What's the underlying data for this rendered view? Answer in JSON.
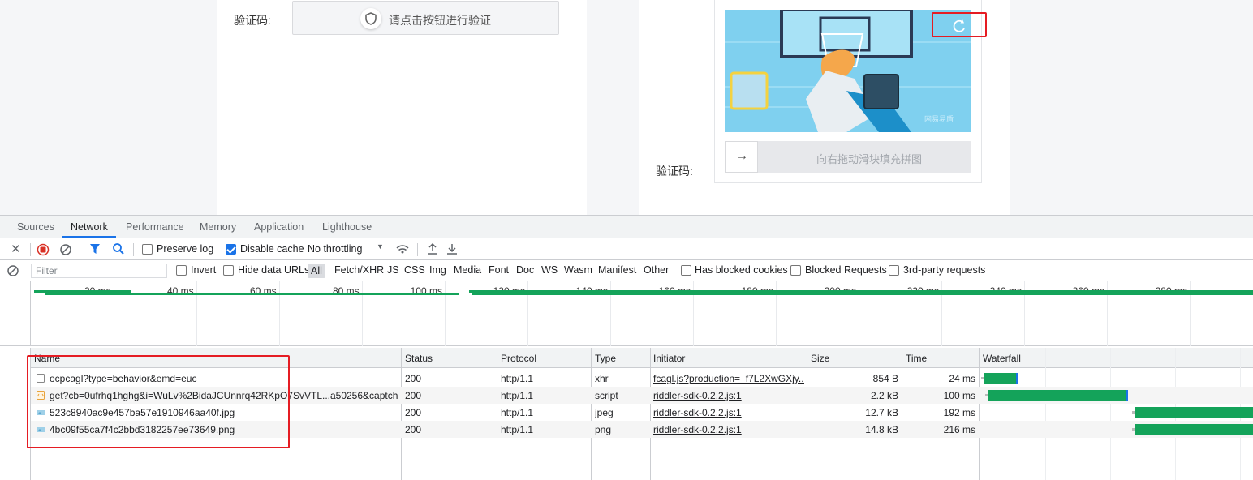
{
  "page": {
    "left_panel": {
      "label": "验证码:",
      "button_text": "请点击按钮进行验证"
    },
    "right_panel": {
      "label": "验证码:",
      "slider_text": "向右拖动滑块填充拼图",
      "handle_icon": "arrow-right-icon",
      "refresh_icon": "refresh-icon",
      "watermark": "网易易盾"
    }
  },
  "devtools": {
    "tabs": [
      "Sources",
      "Network",
      "Performance",
      "Memory",
      "Application",
      "Lighthouse"
    ],
    "active_tab": "Network",
    "toolbar": {
      "preserve_log": "Preserve log",
      "disable_cache": "Disable cache",
      "throttling": "No throttling"
    },
    "filter": {
      "placeholder": "Filter",
      "invert": "Invert",
      "hide_data_urls": "Hide data URLs",
      "all": "All",
      "types": [
        "Fetch/XHR",
        "JS",
        "CSS",
        "Img",
        "Media",
        "Font",
        "Doc",
        "WS",
        "Wasm",
        "Manifest",
        "Other"
      ],
      "has_blocked_cookies": "Has blocked cookies",
      "blocked_requests": "Blocked Requests",
      "third_party": "3rd-party requests"
    },
    "overview_ticks": [
      "20 ms",
      "40 ms",
      "60 ms",
      "80 ms",
      "100 ms",
      "120 ms",
      "140 ms",
      "160 ms",
      "180 ms",
      "200 ms",
      "220 ms",
      "240 ms",
      "260 ms",
      "280 ms",
      "300"
    ],
    "columns": [
      "Name",
      "Status",
      "Protocol",
      "Type",
      "Initiator",
      "Size",
      "Time",
      "Waterfall"
    ],
    "requests": [
      {
        "name": "ocpcagl?type=behavior&emd=euc",
        "status": "200",
        "protocol": "http/1.1",
        "type": "xhr",
        "initiator": "fcagl.js?production=_f7L2XwGXjy...",
        "size": "854 B",
        "time": "24 ms",
        "icon": "document-icon",
        "waterfall_start_ms": 0,
        "waterfall_end_ms": 24
      },
      {
        "name": "get?cb=0ufrhq1hghg&i=WuLv%2BidaJCUnnrq42RKpO7SvVTL...a50256&captch...",
        "status": "200",
        "protocol": "http/1.1",
        "type": "script",
        "initiator": "riddler-sdk-0.2.2.js:1",
        "size": "2.2 kB",
        "time": "100 ms",
        "icon": "script-icon",
        "waterfall_start_ms": 3,
        "waterfall_end_ms": 103
      },
      {
        "name": "523c8940ac9e457ba57e1910946aa40f.jpg",
        "status": "200",
        "protocol": "http/1.1",
        "type": "jpeg",
        "initiator": "riddler-sdk-0.2.2.js:1",
        "size": "12.7 kB",
        "time": "192 ms",
        "icon": "image-icon",
        "waterfall_start_ms": 108,
        "waterfall_end_ms": 300
      },
      {
        "name": "4bc09f55ca7f4c2bbd3182257ee73649.png",
        "status": "200",
        "protocol": "http/1.1",
        "type": "png",
        "initiator": "riddler-sdk-0.2.2.js:1",
        "size": "14.8 kB",
        "time": "216 ms",
        "icon": "image-icon",
        "waterfall_start_ms": 108,
        "waterfall_end_ms": 324
      }
    ]
  }
}
